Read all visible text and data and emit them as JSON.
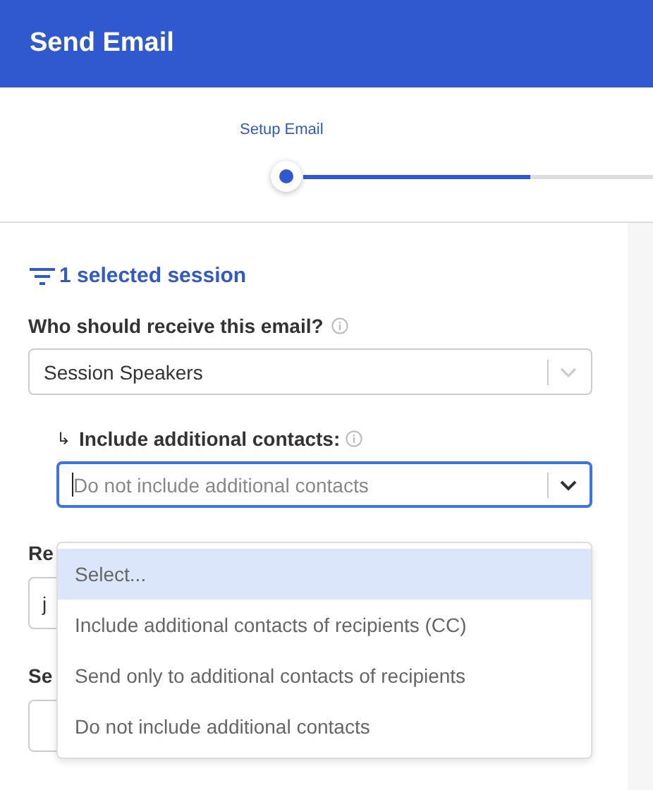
{
  "header": {
    "title": "Send Email"
  },
  "stepper": {
    "steps": [
      {
        "label": "Setup Email",
        "selected": true
      }
    ],
    "level": 0.65
  },
  "selection": {
    "label": "1 selected session"
  },
  "recipients": {
    "label": "Who should receive this email?",
    "value": "Session Speakers"
  },
  "additional": {
    "arrow": "↳",
    "label": "Include additional contacts:",
    "placeholder": "Do not include additional contacts",
    "focused": true,
    "options": [
      {
        "label": "Select...",
        "selected": true
      },
      {
        "label": "Include additional contacts of recipients (CC)",
        "selected": false
      },
      {
        "label": "Send only to additional contacts of recipients",
        "selected": false
      },
      {
        "label": "Do not include additional contacts",
        "selected": false
      }
    ]
  },
  "reply_to": {
    "label": "Re",
    "value": "j"
  },
  "sender": {
    "label": "Se"
  }
}
